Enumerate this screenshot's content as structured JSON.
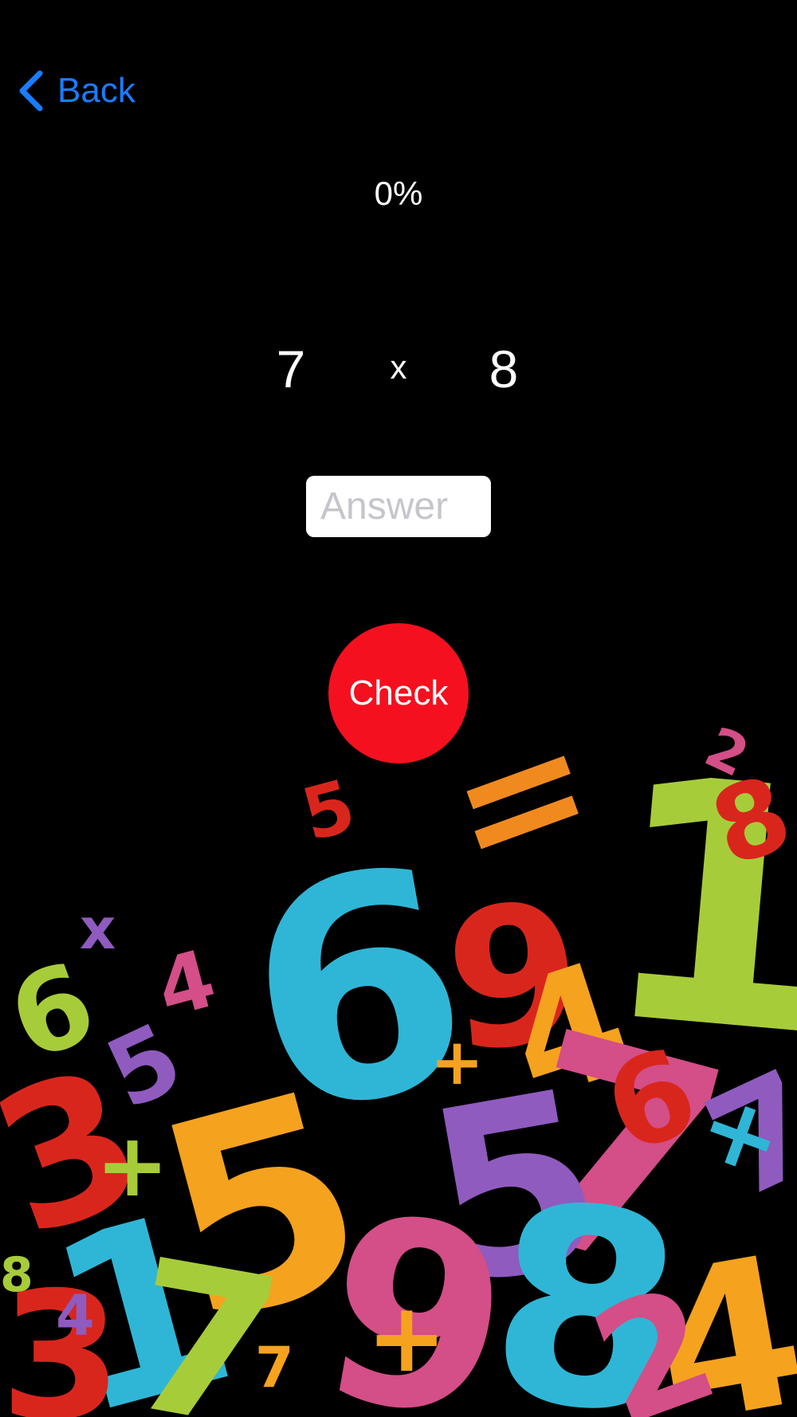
{
  "nav": {
    "back_label": "Back",
    "icon": "chevron-left-icon",
    "accent_color": "#1a7cff"
  },
  "progress": {
    "label": "0%",
    "value": 0
  },
  "problem": {
    "left_operand": "7",
    "operator": "x",
    "right_operand": "8"
  },
  "answer": {
    "placeholder": "Answer",
    "value": ""
  },
  "check_button": {
    "label": "Check",
    "color": "#f5101f"
  },
  "background_art": {
    "description_icon": "colorful-3d-numbers-image",
    "glyphs": [
      "6",
      "9",
      "7",
      "8",
      "5",
      "3",
      "1",
      "4",
      "2",
      "x",
      "+",
      "="
    ]
  }
}
